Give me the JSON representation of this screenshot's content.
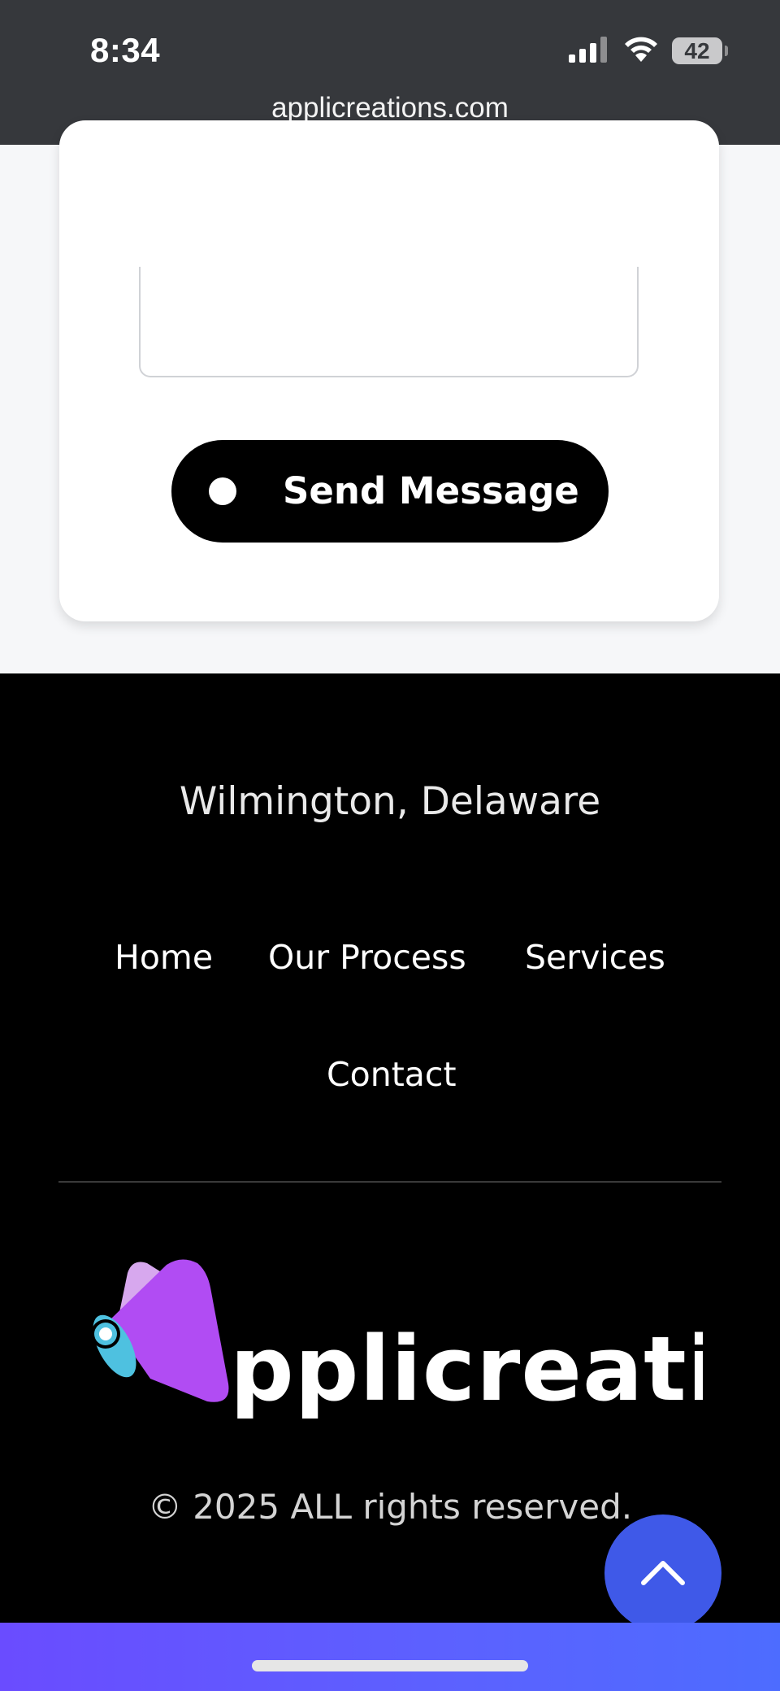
{
  "status_bar": {
    "time": "8:34",
    "battery": "42",
    "url": "applicreations.com"
  },
  "form": {
    "send_label": "Send Message"
  },
  "footer": {
    "location": "Wilmington, Delaware",
    "nav": [
      {
        "label": "Home"
      },
      {
        "label": "Our Process"
      },
      {
        "label": "Services"
      },
      {
        "label": "Contact"
      }
    ],
    "logo_text": "pplicreations",
    "copyright": "© 2025 ALL rights reserved."
  },
  "colors": {
    "status_bg": "#36383c",
    "page_bg": "#f6f7f9",
    "footer_bg": "#000000",
    "logo_purple": "#b14cf3",
    "logo_light_purple": "#d7a8ee",
    "logo_cyan": "#4ec1e0",
    "scroll_button": "#3f59e8",
    "bottom_gradient_start": "#6a4cff",
    "bottom_gradient_end": "#4d6cff"
  },
  "icons": {
    "signal": "cellular-signal-icon",
    "wifi": "wifi-icon",
    "battery": "battery-icon",
    "send": "dot-icon",
    "scroll_top": "chevron-up-icon"
  }
}
